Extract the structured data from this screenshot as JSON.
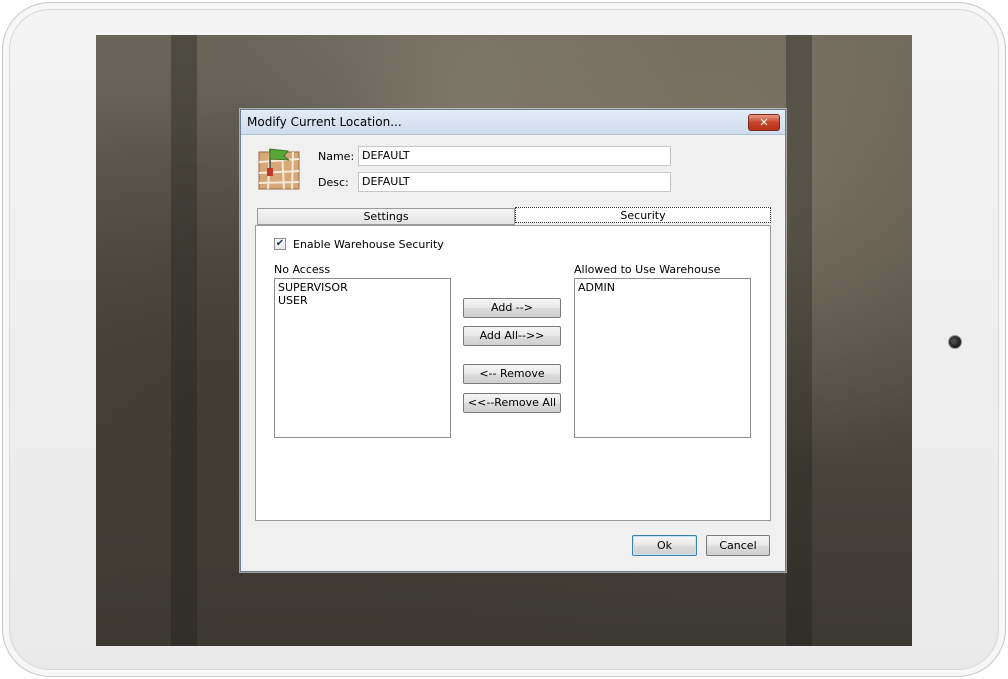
{
  "dialog": {
    "title": "Modify Current Location...",
    "close_glyph": "✕",
    "icon": "map-location-icon",
    "name_label": "Name:",
    "name_value": "DEFAULT",
    "desc_label": "Desc:",
    "desc_value": "DEFAULT"
  },
  "tabs": [
    {
      "label": "Settings",
      "active": false
    },
    {
      "label": "Security",
      "active": true
    }
  ],
  "security": {
    "enable_label": "Enable Warehouse Security",
    "enable_checked": true,
    "check_glyph": "✔",
    "no_access_label": "No Access",
    "no_access_items": [
      "SUPERVISOR",
      "USER"
    ],
    "allowed_label": "Allowed to Use Warehouse",
    "allowed_items": [
      "ADMIN"
    ],
    "add_label": "Add -->",
    "add_all_label": "Add All-->>",
    "remove_label": "<-- Remove",
    "remove_all_label": "<<--Remove All"
  },
  "footer": {
    "ok_label": "Ok",
    "cancel_label": "Cancel"
  },
  "colors": {
    "titlebar": "#cfdcec",
    "close_button": "#c7452a",
    "default_button_border": "#3c7fb1"
  }
}
